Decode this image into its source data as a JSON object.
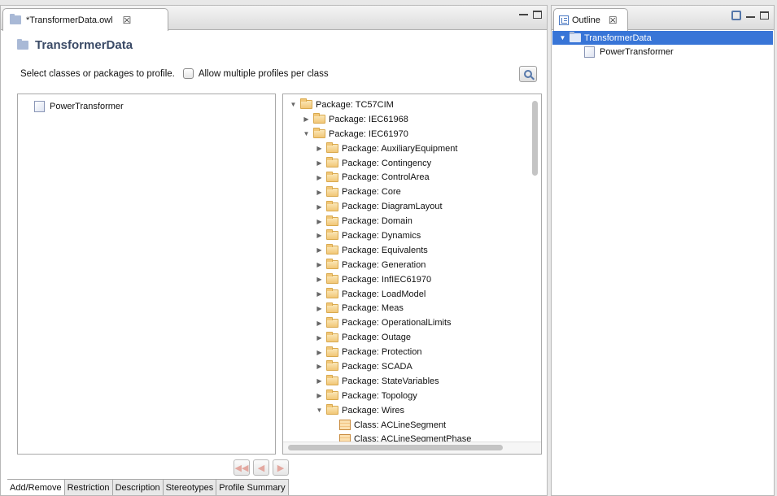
{
  "editor": {
    "tab_title": "*TransformerData.owl",
    "form_title": "TransformerData",
    "select_prompt": "Select classes or packages to profile.",
    "allow_multiple_label": "Allow multiple profiles per class",
    "allow_multiple_checked": false,
    "selected_classes": [
      "PowerTransformer"
    ],
    "tree": [
      {
        "label": "Package: TC57CIM",
        "level": 0,
        "kind": "package",
        "state": "expanded"
      },
      {
        "label": "Package: IEC61968",
        "level": 1,
        "kind": "package",
        "state": "collapsed"
      },
      {
        "label": "Package: IEC61970",
        "level": 1,
        "kind": "package",
        "state": "expanded"
      },
      {
        "label": "Package: AuxiliaryEquipment",
        "level": 2,
        "kind": "package",
        "state": "collapsed"
      },
      {
        "label": "Package: Contingency",
        "level": 2,
        "kind": "package",
        "state": "collapsed"
      },
      {
        "label": "Package: ControlArea",
        "level": 2,
        "kind": "package",
        "state": "collapsed"
      },
      {
        "label": "Package: Core",
        "level": 2,
        "kind": "package",
        "state": "collapsed"
      },
      {
        "label": "Package: DiagramLayout",
        "level": 2,
        "kind": "package",
        "state": "collapsed"
      },
      {
        "label": "Package: Domain",
        "level": 2,
        "kind": "package",
        "state": "collapsed"
      },
      {
        "label": "Package: Dynamics",
        "level": 2,
        "kind": "package",
        "state": "collapsed"
      },
      {
        "label": "Package: Equivalents",
        "level": 2,
        "kind": "package",
        "state": "collapsed"
      },
      {
        "label": "Package: Generation",
        "level": 2,
        "kind": "package",
        "state": "collapsed"
      },
      {
        "label": "Package: InfIEC61970",
        "level": 2,
        "kind": "package",
        "state": "collapsed"
      },
      {
        "label": "Package: LoadModel",
        "level": 2,
        "kind": "package",
        "state": "collapsed"
      },
      {
        "label": "Package: Meas",
        "level": 2,
        "kind": "package",
        "state": "collapsed"
      },
      {
        "label": "Package: OperationalLimits",
        "level": 2,
        "kind": "package",
        "state": "collapsed"
      },
      {
        "label": "Package: Outage",
        "level": 2,
        "kind": "package",
        "state": "collapsed"
      },
      {
        "label": "Package: Protection",
        "level": 2,
        "kind": "package",
        "state": "collapsed"
      },
      {
        "label": "Package: SCADA",
        "level": 2,
        "kind": "package",
        "state": "collapsed"
      },
      {
        "label": "Package: StateVariables",
        "level": 2,
        "kind": "package",
        "state": "collapsed"
      },
      {
        "label": "Package: Topology",
        "level": 2,
        "kind": "package",
        "state": "collapsed"
      },
      {
        "label": "Package: Wires",
        "level": 2,
        "kind": "package",
        "state": "expanded"
      },
      {
        "label": "Class: ACLineSegment",
        "level": 3,
        "kind": "class",
        "state": "leaf"
      },
      {
        "label": "Class: ACLineSegmentPhase",
        "level": 3,
        "kind": "class",
        "state": "leaf"
      }
    ],
    "nav_buttons": [
      {
        "name": "remove-all-button",
        "glyph": "◀◀"
      },
      {
        "name": "remove-button",
        "glyph": "◀"
      },
      {
        "name": "add-button",
        "glyph": "▶"
      }
    ],
    "bottom_tabs": [
      "Add/Remove",
      "Restriction",
      "Description",
      "Stereotypes",
      "Profile Summary"
    ],
    "active_bottom_tab": "Add/Remove"
  },
  "outline": {
    "tab_title": "Outline",
    "root": "TransformerData",
    "children": [
      "PowerTransformer"
    ]
  },
  "glyphs": {
    "close": "☒",
    "expanded": "▼",
    "collapsed": "▶"
  },
  "colors": {
    "selection": "#3875d7",
    "title": "#3a4a66"
  }
}
